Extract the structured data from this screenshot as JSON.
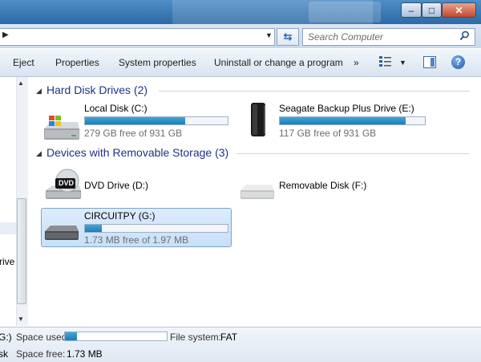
{
  "window": {
    "minimize_glyph": "–",
    "maximize_glyph": "□",
    "close_glyph": "✕"
  },
  "address_bar": {
    "search_placeholder": "Search Computer"
  },
  "toolbar": {
    "items": [
      "Eject",
      "Properties",
      "System properties",
      "Uninstall or change a program"
    ],
    "overflow": "»",
    "help_glyph": "?"
  },
  "nav_pane": {
    "visible_item_fragment": "rive"
  },
  "groups": [
    {
      "title": "Hard Disk Drives (2)",
      "drives": [
        {
          "name": "Local Disk (C:)",
          "free_text": "279 GB free of 931 GB",
          "used_fraction": 0.7,
          "icon": "windows-hard-drive-icon"
        },
        {
          "name": "Seagate Backup Plus Drive (E:)",
          "free_text": "117 GB free of 931 GB",
          "used_fraction": 0.87,
          "icon": "external-hard-drive-icon"
        }
      ]
    },
    {
      "title": "Devices with Removable Storage (3)",
      "drives": [
        {
          "name": "DVD Drive (D:)",
          "icon": "dvd-drive-icon",
          "icon_label": "DVD"
        },
        {
          "name": "Removable Disk (F:)",
          "icon": "removable-disk-icon"
        },
        {
          "name": "CIRCUITPY (G:)",
          "free_text": "1.73 MB free of 1.97 MB",
          "used_fraction": 0.12,
          "icon": "removable-drive-icon",
          "selected": true
        }
      ]
    }
  ],
  "details_pane": {
    "name_fragment": "G:)",
    "type_fragment": "sk",
    "space_used_label": "Space used:",
    "space_used_fraction": 0.12,
    "space_free_label": "Space free:",
    "space_free_value": "1.73 MB",
    "file_system_label": "File system:",
    "file_system_value": "FAT"
  },
  "colors": {
    "header_text": "#1e3287",
    "bar_fill": "#2a8fc8",
    "selection": "#cfe4fa"
  }
}
